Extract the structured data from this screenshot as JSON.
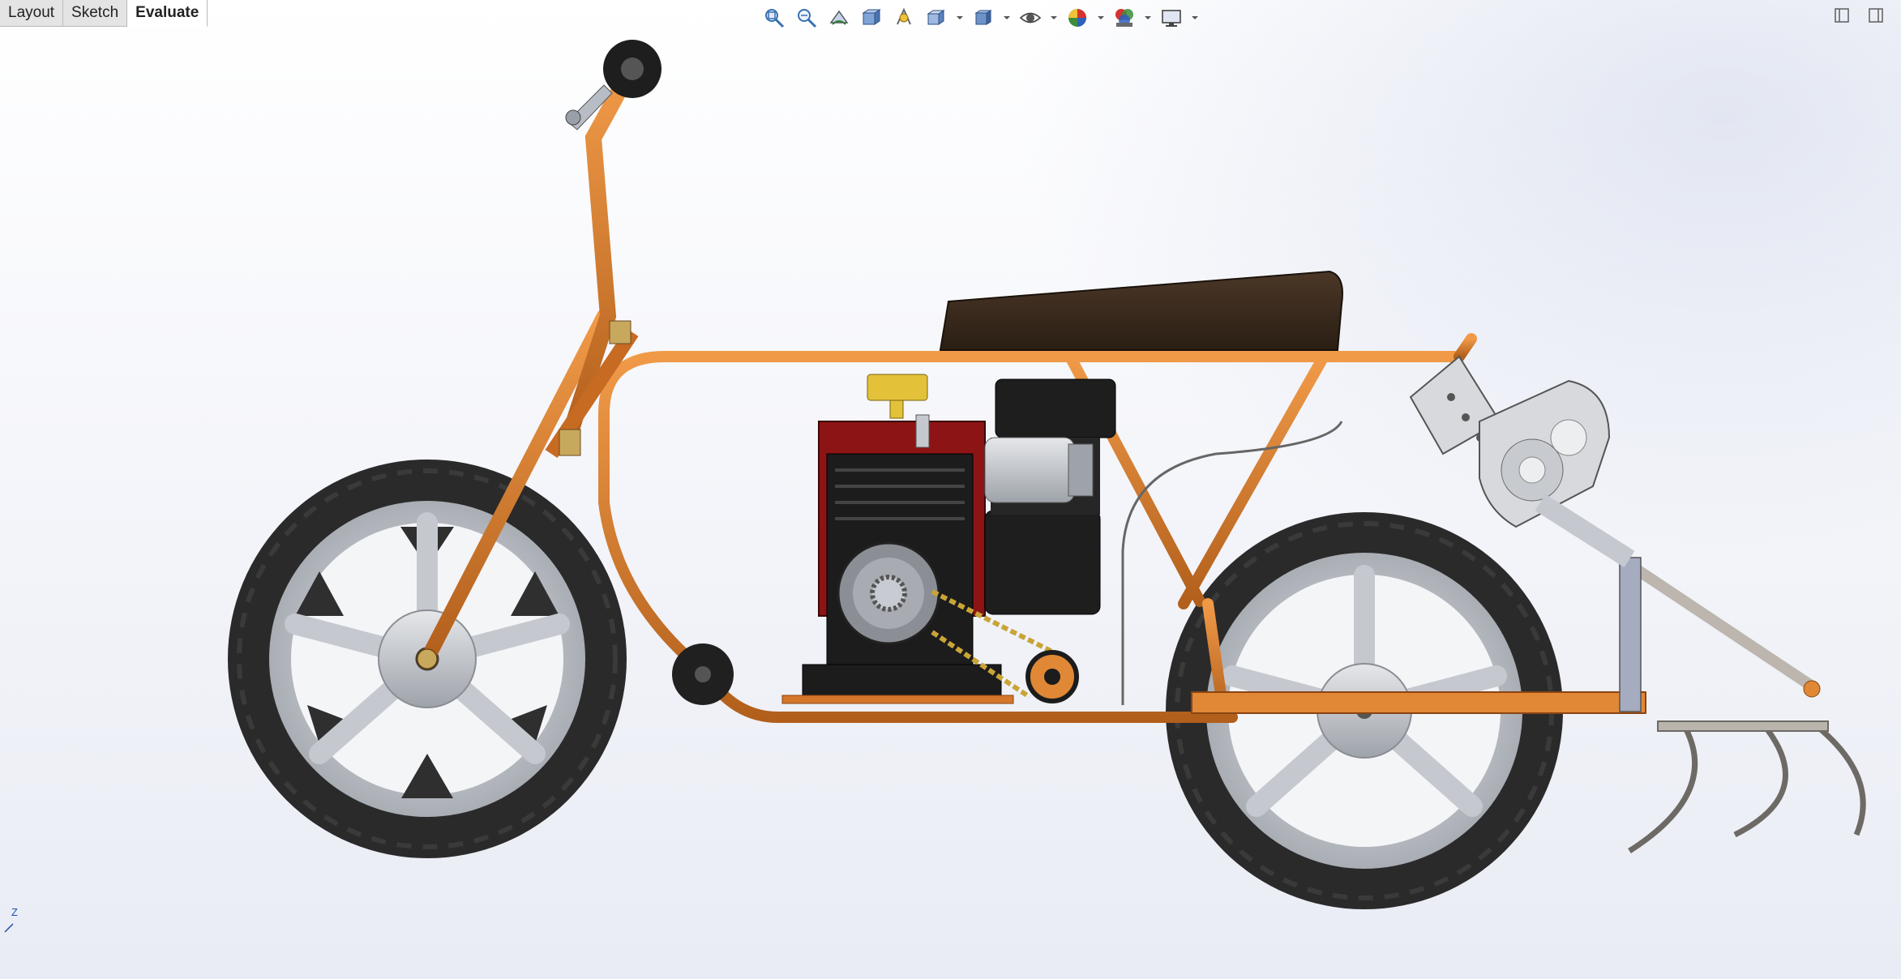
{
  "tabs": [
    {
      "label": "Layout",
      "active": false
    },
    {
      "label": "Sketch",
      "active": false
    },
    {
      "label": "Evaluate",
      "active": true
    }
  ],
  "hud_icons": [
    "zoom-to-fit-icon",
    "zoom-to-area-icon",
    "previous-view-icon",
    "section-view-icon",
    "dynamic-annotation-icon",
    "view-orientation-icon",
    "display-style-icon",
    "hide-show-items-icon",
    "edit-appearance-icon",
    "apply-scene-icon",
    "view-settings-icon"
  ],
  "triad": {
    "axis_label": "Z"
  },
  "colors": {
    "frame": "#d4772b",
    "frame_dark": "#8a4412",
    "tire": "#2a2a2a",
    "rim": "#c9ccd1",
    "seat": "#3b2b1d",
    "engine": "#1c1c1c",
    "engine_red": "#8d1414",
    "fuel_cap": "#e3c23a"
  }
}
